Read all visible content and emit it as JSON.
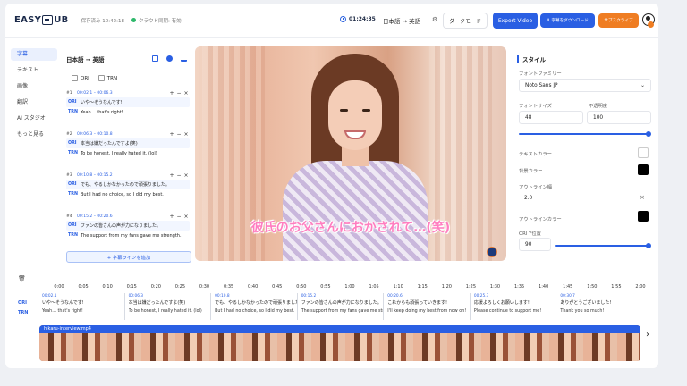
{
  "header": {
    "logo_left": "EASY",
    "logo_right": "UB",
    "save_status": "保存済み 10:42:18",
    "sync_status": "クラウド同期: 有効",
    "timer": "01:24:35",
    "language_pair": "日本語 → 英語",
    "dark_mode_label": "ダークモード",
    "export_label": "Export Video",
    "download_label": "⬇ 字幕をダウンロード",
    "subscribe_label": "サブスクライブ",
    "accent_color": "#2a5fe3",
    "subscribe_color": "#ef7d22"
  },
  "sidebar": {
    "items": [
      {
        "label": "字幕",
        "icon": "subtitle-icon",
        "active": true
      },
      {
        "label": "テキスト",
        "icon": "text-icon"
      },
      {
        "label": "画像",
        "icon": "image-icon"
      },
      {
        "label": "翻訳",
        "icon": "translate-icon"
      },
      {
        "label": "AI スタジオ",
        "icon": "ai-studio-icon"
      },
      {
        "label": "もっと見る",
        "icon": "more-icon"
      }
    ]
  },
  "subtitles": {
    "title": "日本語 → 英語",
    "filter_ori": "ORI",
    "filter_trn": "TRN",
    "tag_ori": "ORI",
    "tag_trn": "TRN",
    "entries": [
      {
        "num": "#1",
        "time": "00:02.1 – 00:06.3",
        "ori": "いや〜そうなんです!",
        "trn": "Yeah… that's right!"
      },
      {
        "num": "#2",
        "time": "00:06.3 – 00:10.8",
        "ori": "本当は嫌だったんですよ(笑)",
        "trn": "To be honest, I really hated it. (lol)"
      },
      {
        "num": "#3",
        "time": "00:10.8 – 00:15.2",
        "ori": "でも、やるしかなかったので頑張りました。",
        "trn": "But I had no choice, so I did my best."
      },
      {
        "num": "#4",
        "time": "00:15.2 – 00:20.6",
        "ori": "ファンの皆さんの声が力になりました。",
        "trn": "The support from my fans gave me strength."
      }
    ],
    "add_label": "+ 字幕ラインを追加"
  },
  "video": {
    "caption": "彼氏のお父さんにおかされて…(笑)"
  },
  "style": {
    "title": "スタイル",
    "font_family_label": "フォントファミリー",
    "font_family_value": "Noto Sans JP",
    "font_size_label": "フォントサイズ",
    "font_size_value": "48",
    "opacity_label": "不透明度",
    "opacity_value": "100",
    "text_color_label": "テキストカラー",
    "bg_color_label": "背景カラー",
    "outline_width_label": "アウトライン幅",
    "outline_width_value": "2.0",
    "outline_color_label": "アウトラインカラー",
    "ori_y_label": "ORI Y位置",
    "ori_y_value": "90",
    "text_color": "#ffffff",
    "bg_color": "#000000",
    "outline_color": "#000000"
  },
  "timeline": {
    "ticks": [
      "0:00",
      "0:05",
      "0:10",
      "0:15",
      "0:20",
      "0:25",
      "0:30",
      "0:35",
      "0:40",
      "0:45",
      "0:50",
      "0:55",
      "1:00",
      "1:05",
      "1:10",
      "1:15",
      "1:20",
      "1:25",
      "1:30",
      "1:35",
      "1:40",
      "1:45",
      "1:50",
      "1:55",
      "2:00"
    ],
    "label_ori": "ORI",
    "label_trn": "TRN",
    "cues": [
      {
        "time": "00:02.1",
        "ori": "いや〜そうなんです!",
        "trn": "Yeah… that's right!"
      },
      {
        "time": "00:06.3",
        "ori": "本当は嫌だったんですよ(笑)",
        "trn": "To be honest, I really hated it. (lol)"
      },
      {
        "time": "00:10.8",
        "ori": "でも、やるしかなかったので頑張りました。",
        "trn": "But I had no choice, so I did my best."
      },
      {
        "time": "00:15.2",
        "ori": "ファンの皆さんの声が力になりました。",
        "trn": "The support from my fans gave me strength."
      },
      {
        "time": "00:20.6",
        "ori": "これからも頑張っていきます!",
        "trn": "I'll keep doing my best from now on!"
      },
      {
        "time": "00:25.3",
        "ori": "応援よろしくお願いします!",
        "trn": "Please continue to support me!"
      },
      {
        "time": "00:30.7",
        "ori": "ありがとうございました!",
        "trn": "Thank you so much!"
      }
    ],
    "clip_name": "hikaru-interview.mp4"
  }
}
